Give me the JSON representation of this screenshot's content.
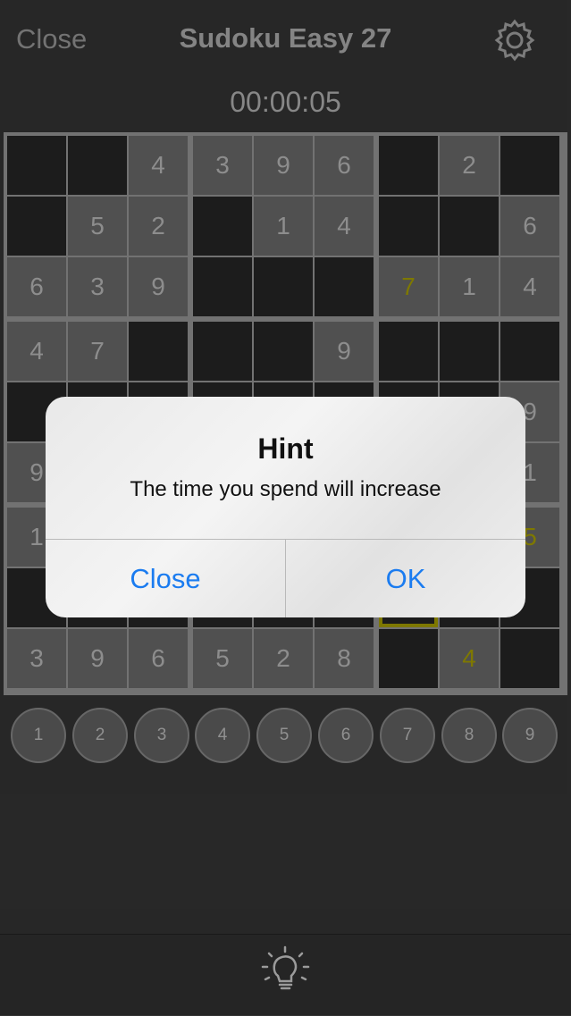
{
  "nav": {
    "close_label": "Close",
    "title": "Sudoku Easy 27",
    "settings_icon": "gear-icon"
  },
  "timer": "00:00:05",
  "board": {
    "rows": [
      [
        "",
        "",
        "4",
        "3",
        "9",
        "6",
        "",
        "2",
        ""
      ],
      [
        "",
        "5",
        "2",
        "",
        "1",
        "4",
        "",
        "",
        "6"
      ],
      [
        "6",
        "3",
        "9",
        "",
        "",
        "",
        "7",
        "1",
        "4"
      ],
      [
        "4",
        "7",
        "",
        "",
        "",
        "9",
        "",
        "",
        ""
      ],
      [
        "",
        "",
        "",
        "",
        "",
        "",
        "",
        "",
        "9"
      ],
      [
        "9",
        "",
        "",
        "",
        "",
        "",
        "",
        "",
        "1"
      ],
      [
        "1",
        "",
        "",
        "",
        "",
        "",
        "",
        "",
        "5"
      ],
      [
        "",
        "",
        "",
        "",
        "",
        "",
        "",
        "",
        ""
      ],
      [
        "3",
        "9",
        "6",
        "5",
        "2",
        "8",
        "",
        "4",
        ""
      ]
    ],
    "user_entries": [
      [
        2,
        6
      ],
      [
        6,
        8
      ],
      [
        8,
        7
      ]
    ],
    "selected_cell": [
      7,
      6
    ],
    "colors": {
      "given_bg": "#6b6b6b",
      "empty_bg": "#262626",
      "user_digit": "#a8a100",
      "grid": "#999999"
    }
  },
  "numpad": [
    "1",
    "2",
    "3",
    "4",
    "5",
    "6",
    "7",
    "8",
    "9"
  ],
  "toolbar": {
    "hint_icon": "lightbulb-icon"
  },
  "alert": {
    "title": "Hint",
    "message": "The time you spend will increase",
    "buttons": [
      "Close",
      "OK"
    ],
    "button_color": "#1b7cf0"
  }
}
